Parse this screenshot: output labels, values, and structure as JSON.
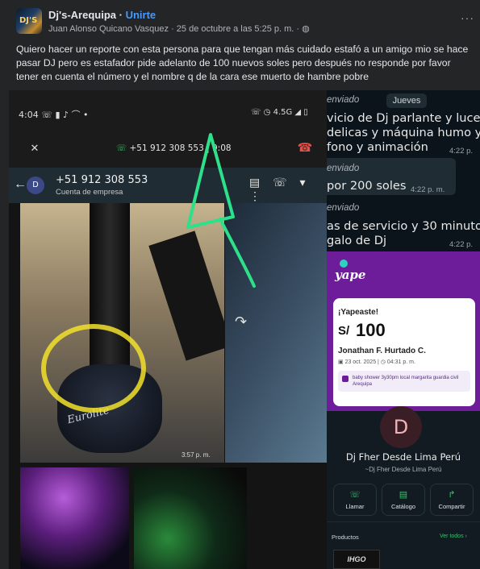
{
  "post": {
    "group_name": "Dj's-Arequipa",
    "separator": " · ",
    "join_label": "Unirte",
    "author": "Juan Alonso Quicano Vasquez",
    "timestamp": "25 de octubre a las 5:25 p. m.",
    "audience_icon": "globe-icon",
    "more_label": "···",
    "avatar_text": "DJ'S",
    "text": "Quiero hacer un reporte con esta persona para que tengan más cuidado estafó a un amigo mio se hace pasar DJ pero es estafador pide adelanto de 100 nuevos soles pero después no responde por favor tener en cuenta el número y el nombre q de la cara ese muerto de hambre pobre"
  },
  "left_screenshot": {
    "status_time": "4:04",
    "status_icons_left": "☏ ▮ ♪ ⌒ •",
    "status_icons_right": "☏ ◷ 4.5G ◢ ▯",
    "call_number": "+51 912 308 553 | 9:08",
    "mute_icon": "mic-off-icon",
    "hangup_icon": "phone-hangup-icon",
    "contact_avatar": "D",
    "contact_number": "+51 912 308 553",
    "contact_subtitle": "Cuenta de empresa",
    "header_icons": "▤ ☏ ▾ ⋮",
    "photo_time": "3:57 p. m.",
    "speaker_brand": "Eurolite",
    "forward_icon": "↷"
  },
  "right_screenshot": {
    "day_label": "Jueves",
    "msg1_status": "enviado",
    "msg1_lines": [
      "vicio de Dj parlante y luces",
      "delicas y máquina humo y",
      "fono y animación"
    ],
    "msg1_time": "4:22 p.",
    "msg2_status": "enviado",
    "msg2_text": "por 200 soles",
    "msg2_time": "4:22 p. m.",
    "msg3_status": "enviado",
    "msg3_lines": [
      "as de servicio y 30 minutos",
      "galo de Dj"
    ],
    "msg3_time": "4:22 p.",
    "yape": {
      "logo": "yape",
      "title": "¡Yapeaste!",
      "currency": "S/",
      "amount": "100",
      "recipient": "Jonathan F. Hurtado C.",
      "date": "23 oct. 2025",
      "time": "04:31 p. m.",
      "message": "baby shower 3y30pm local margarita guardia civil Arequipa"
    },
    "profile": {
      "avatar": "D",
      "name": "Dj Fher Desde Lima Perú",
      "subtitle": "~Dj Fher Desde Lima Perú",
      "call_label": "Llamar",
      "catalog_label": "Catálogo",
      "share_label": "Compartir",
      "products_label": "Productos",
      "see_all_label": "Ver todos  ›",
      "product_thumb": "IHGO"
    }
  },
  "colors": {
    "bg": "#242526",
    "link": "#4599ff",
    "yape_purple": "#6d1d9a",
    "whatsapp_green": "#35c36b",
    "annotation_green": "#2de08a"
  }
}
